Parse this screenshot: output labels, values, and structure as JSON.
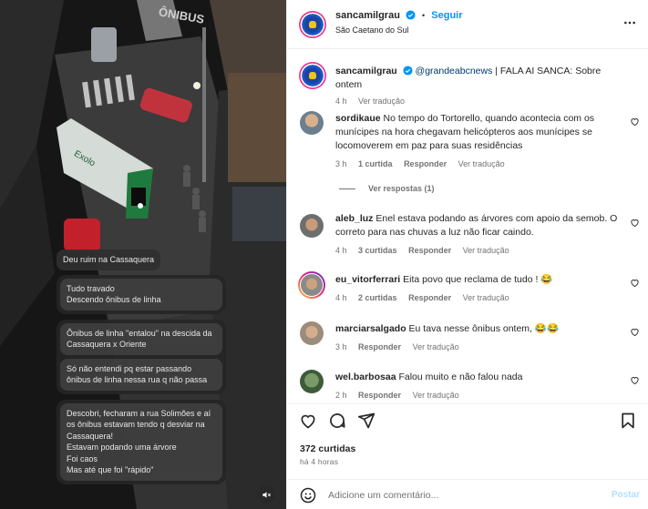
{
  "media": {
    "sign_text": "ÔNIBUS",
    "bus_text": "Exolo",
    "messages": [
      {
        "text": "Deu ruim na Cassaquera"
      },
      {
        "group": [
          "Tudo travado\nDescendo ônibus de linha"
        ]
      },
      {
        "group": [
          "Ônibus de linha \"entalou\" na descida da Cassaquera x Oriente",
          "Só não entendi pq estar passando ônibus de linha nessa rua q não passa"
        ]
      },
      {
        "group": [
          "Descobri, fecharam a rua Solimões e aí os ônibus estavam tendo q desviar na Cassaquera!\nEstavam podando uma árvore\nFoi caos\nMas até que foi \"rápido\""
        ]
      }
    ],
    "mute_icon": "speaker-muted-icon"
  },
  "header": {
    "username": "sancamilgrau",
    "follow_label": "Seguir",
    "separator": "•",
    "location": "São Caetano do Sul",
    "more_icon": "more-horizontal-icon"
  },
  "caption": {
    "username": "sancamilgrau",
    "mention": "@grandeabcnews",
    "text": " | FALA AI SANCA: Sobre ontem",
    "time": "4 h",
    "translate": "Ver tradução"
  },
  "comments": [
    {
      "username": "sordikaue",
      "text": "No tempo do Tortorello, quando acontecia com os munícipes na hora chegavam helicópteros aos munícipes se locomoverem em paz para suas residências",
      "time": "3 h",
      "likes": "1 curtida",
      "reply": "Responder",
      "translate": "Ver tradução",
      "view_replies": "Ver respostas (1)"
    },
    {
      "username": "aleb_luz",
      "text": "Enel estava podando as árvores com apoio da semob. O correto para nas chuvas a luz não ficar caindo.",
      "time": "4 h",
      "likes": "3 curtidas",
      "reply": "Responder",
      "translate": "Ver tradução"
    },
    {
      "username": "eu_vitorferrari",
      "text": "Eita povo que reclama de tudo ! 😂",
      "time": "4 h",
      "likes": "2 curtidas",
      "reply": "Responder",
      "translate": "Ver tradução"
    },
    {
      "username": "marciarsalgado",
      "text": "Eu tava nesse ônibus ontem, 😂😂",
      "time": "3 h",
      "reply": "Responder",
      "translate": "Ver tradução"
    },
    {
      "username": "wel.barbosaa",
      "text": "Falou muito e não falou nada",
      "time": "2 h",
      "reply": "Responder",
      "translate": "Ver tradução"
    }
  ],
  "actions": {
    "likes": "372 curtidas",
    "date": "há 4 horas"
  },
  "add_comment": {
    "placeholder": "Adicione um comentário...",
    "post_label": "Postar"
  },
  "colors": {
    "accent": "#0095f6",
    "muted_text": "#737373",
    "link": "#00376b"
  }
}
